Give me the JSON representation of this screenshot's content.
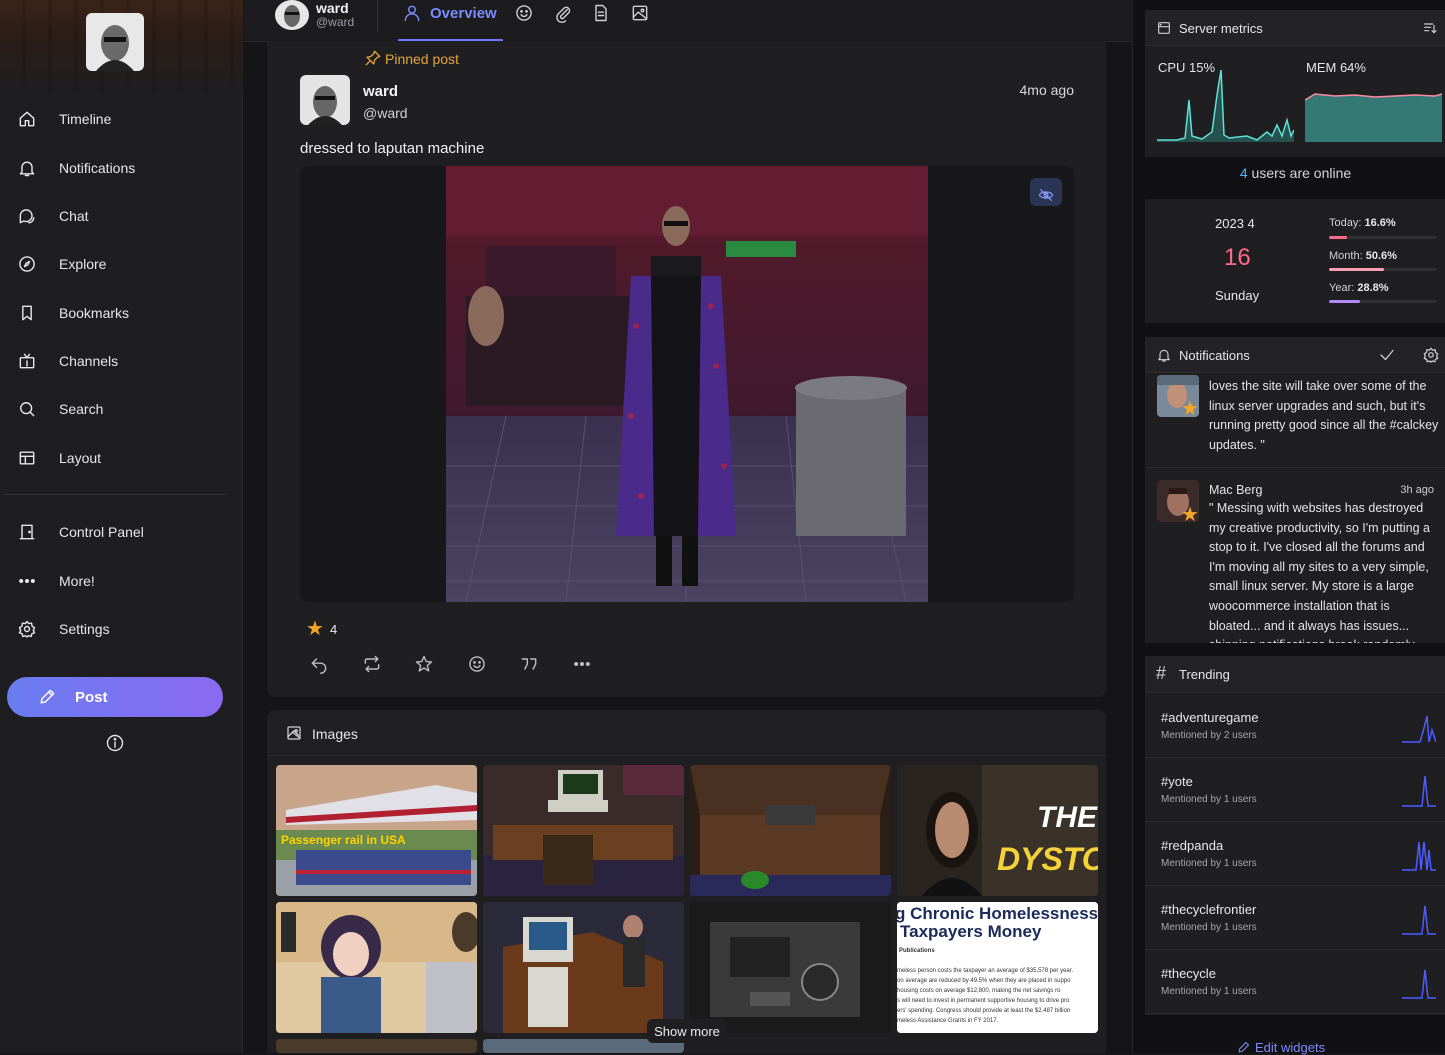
{
  "sidebar": {
    "nav": [
      {
        "label": "Timeline",
        "icon": "home-icon"
      },
      {
        "label": "Notifications",
        "icon": "bell-icon"
      },
      {
        "label": "Chat",
        "icon": "chat-icon"
      },
      {
        "label": "Explore",
        "icon": "compass-icon"
      },
      {
        "label": "Bookmarks",
        "icon": "bookmark-icon"
      },
      {
        "label": "Channels",
        "icon": "channels-icon"
      },
      {
        "label": "Search",
        "icon": "search-icon"
      },
      {
        "label": "Layout",
        "icon": "layout-icon"
      }
    ],
    "nav2": [
      {
        "label": "Control Panel",
        "icon": "door-icon"
      },
      {
        "label": "More!",
        "icon": "dots-icon"
      },
      {
        "label": "Settings",
        "icon": "gear-icon"
      }
    ],
    "post_label": "Post"
  },
  "header": {
    "name": "ward",
    "handle": "@ward",
    "tab_overview": "Overview"
  },
  "post": {
    "pinned_label": "Pinned post",
    "author_name": "ward",
    "author_handle": "@ward",
    "time": "4mo ago",
    "text": "dressed to laputan machine",
    "reaction_count": "4"
  },
  "images": {
    "title": "Images",
    "show_more": "Show more",
    "thumb_captions": {
      "rail": "Passenger rail in USA",
      "dystopia": "THE A DYSTOPI",
      "homeless_title": "g Chronic Homelessness Taxpayers Money",
      "homeless_sub": "Publications",
      "homeless_body": "meless person costs the taxpayer an average of $35,578 per year. on average are reduced by 49.5% when they are placed in support housing costs on average $12,800, making the net savings ro s will need to invest in permanent supportive housing to drive pro ers' spending. Congress should provide at least the $2.487 billion meless Assistance Grants in FY 2017."
    }
  },
  "metrics": {
    "title": "Server metrics",
    "cpu_label": "CPU 15%",
    "mem_label": "MEM 64%",
    "cpu_color": "#5fe0d8",
    "mem_color": "#5ea8a8"
  },
  "online": {
    "count": "4",
    "suffix": " users are online"
  },
  "calendar": {
    "year_month": "2023  4",
    "day": "16",
    "weekday": "Sunday",
    "today_label": "Today:",
    "today_value": "16.6%",
    "today_fraction": 0.166,
    "month_label": "Month:",
    "month_value": "50.6%",
    "month_fraction": 0.506,
    "year_label": "Year:",
    "year_value": "28.8%",
    "year_fraction": 0.288
  },
  "notifications": {
    "title": "Notifications",
    "items": [
      {
        "name": "",
        "time": "",
        "text": "loves the site will take over some of the linux server upgrades and such, but it's running pretty good since all the #calckey updates. \""
      },
      {
        "name": "Mac Berg",
        "time": "3h ago",
        "text": "\" Messing with websites has destroyed my creative productivity, so I'm putting a stop to it. I've closed all the forums and I'm moving all my sites to a very simple, small linux server. My store is a large woocommerce installation that is bloated... and it always has issues... shipping notifications break randomly..."
      }
    ]
  },
  "trending": {
    "title": "Trending",
    "items": [
      {
        "tag": "#adventuregame",
        "sub": "Mentioned by 2 users"
      },
      {
        "tag": "#yote",
        "sub": "Mentioned by 1 users"
      },
      {
        "tag": "#redpanda",
        "sub": "Mentioned by 1 users"
      },
      {
        "tag": "#thecyclefrontier",
        "sub": "Mentioned by 1 users"
      },
      {
        "tag": "#thecycle",
        "sub": "Mentioned by 1 users"
      }
    ]
  },
  "edit_widgets": "Edit widgets"
}
